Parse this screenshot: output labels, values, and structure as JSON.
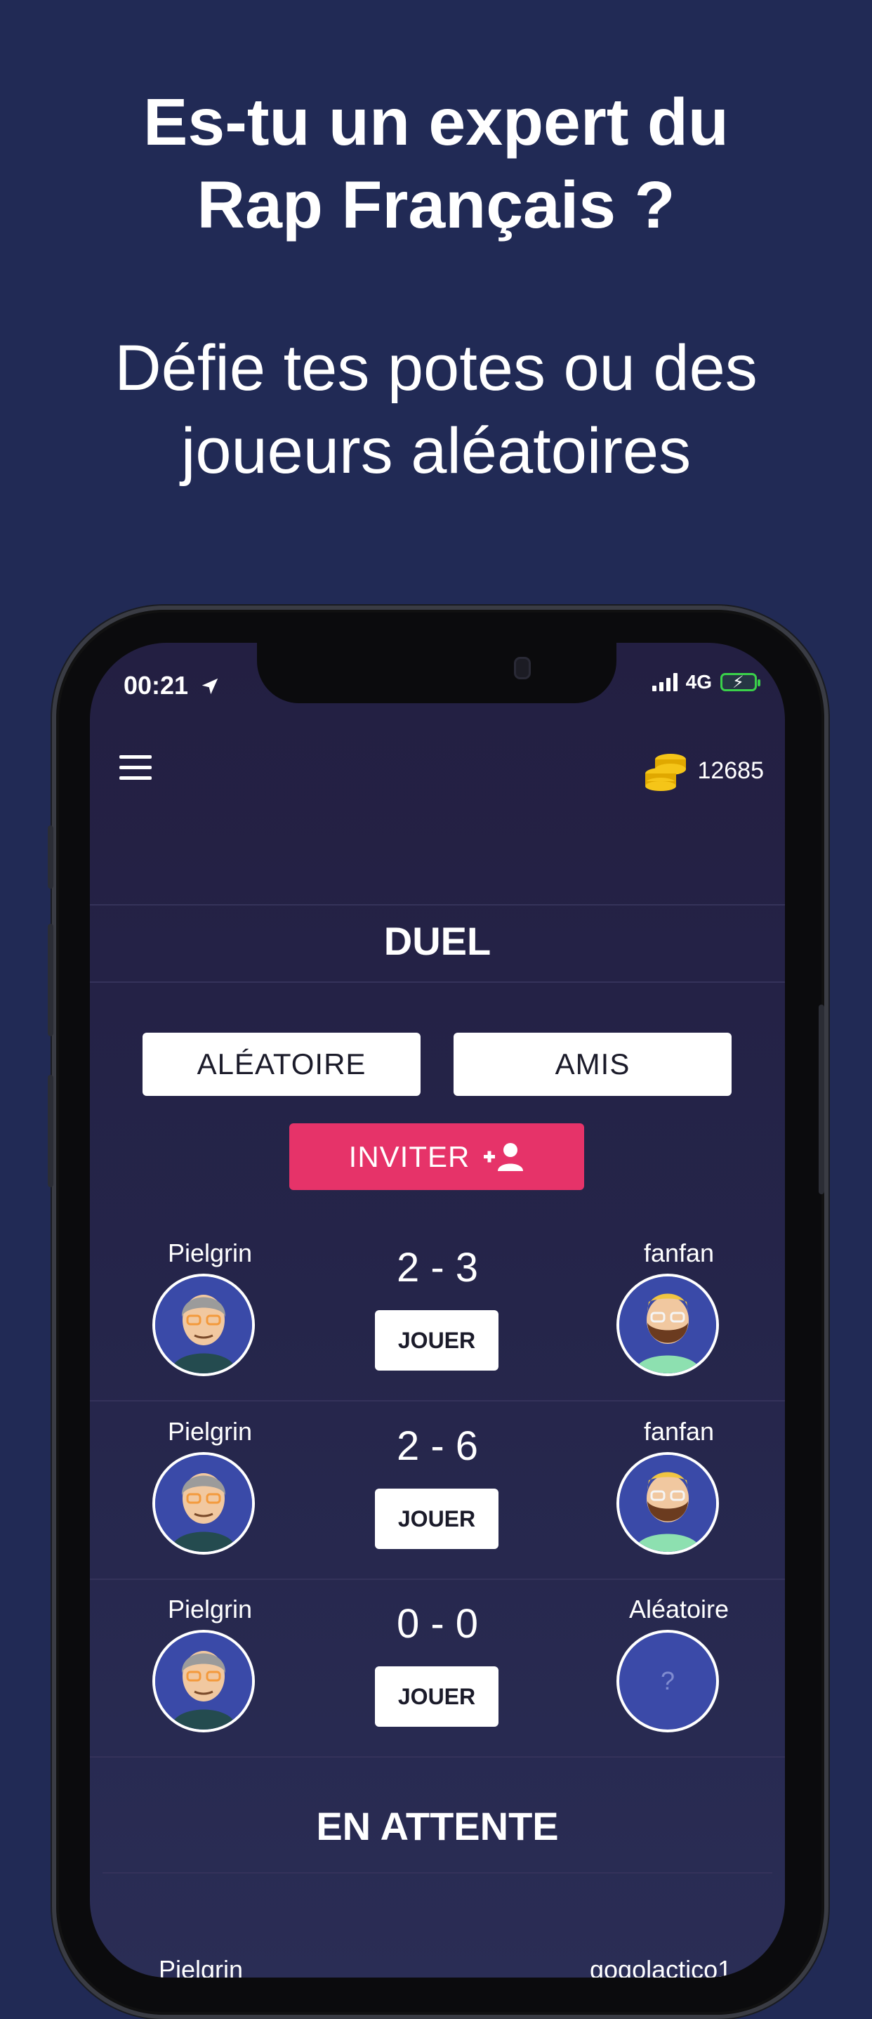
{
  "promo": {
    "headline_line1": "Es-tu un expert du",
    "headline_line2": "Rap Français ?",
    "subline_line1": "Défie tes potes ou des",
    "subline_line2": "joueurs aléatoires"
  },
  "status_bar": {
    "time": "00:21",
    "network": "4G"
  },
  "header": {
    "coins": "12685"
  },
  "duel": {
    "title": "DUEL",
    "random_label": "ALÉATOIRE",
    "friends_label": "AMIS",
    "invite_label": "INVITER"
  },
  "matches": [
    {
      "player": "Pielgrin",
      "opponent": "fanfan",
      "score": "2 - 3",
      "play_label": "JOUER"
    },
    {
      "player": "Pielgrin",
      "opponent": "fanfan",
      "score": "2 - 6",
      "play_label": "JOUER"
    },
    {
      "player": "Pielgrin",
      "opponent": "Aléatoire",
      "score": "0 - 0",
      "play_label": "JOUER"
    }
  ],
  "unknown_avatar_mark": "?",
  "pending": {
    "title": "EN ATTENTE",
    "peek_left": "Pielgrin",
    "peek_right": "gogolactico1"
  },
  "colors": {
    "background": "#212a55",
    "invite": "#e63369",
    "coins": "#f5c518",
    "battery": "#3ad14a"
  }
}
